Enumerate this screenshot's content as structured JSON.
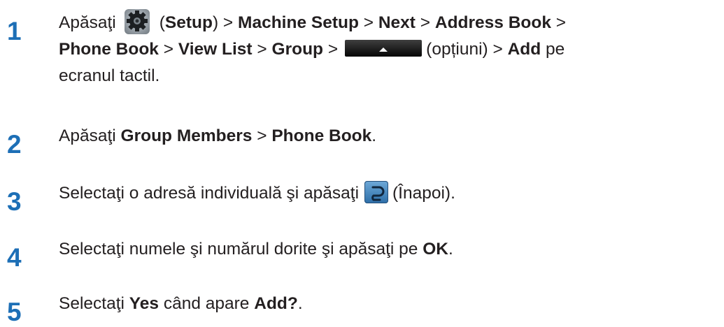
{
  "steps": [
    {
      "number": "1",
      "t1": "Apăsaţi",
      "t2": "(",
      "b1": "Setup",
      "t3": ") > ",
      "b2": "Machine Setup",
      "t4": " > ",
      "b3": "Next",
      "t5": " > ",
      "b4": "Address Book",
      "t6": " >",
      "b5": "Phone Book",
      "t7": " > ",
      "b6": "View List",
      "t8": " > ",
      "b7": "Group",
      "t9": " >",
      "t10": "(opțiuni) > ",
      "b8": "Add",
      "t11": " pe",
      "t12": "ecranul tactil."
    },
    {
      "number": "2",
      "t1": "Apăsaţi ",
      "b1": "Group Members",
      "t2": " > ",
      "b2": "Phone Book",
      "t3": "."
    },
    {
      "number": "3",
      "t1": "Selectaţi o adresă individuală şi apăsaţi",
      "t2": "(Înapoi)."
    },
    {
      "number": "4",
      "t1": "Selectaţi numele şi numărul dorite şi apăsaţi pe ",
      "b1": "OK",
      "t2": "."
    },
    {
      "number": "5",
      "t1": "Selectaţi ",
      "b1": "Yes",
      "t2": " când apare ",
      "b2": "Add?",
      "t3": "."
    }
  ],
  "icons": {
    "setup": "gear-icon",
    "options": "options-button-icon",
    "back": "back-arrow-icon"
  },
  "colors": {
    "step_number": "#1d6fb6",
    "text": "#231f20"
  }
}
